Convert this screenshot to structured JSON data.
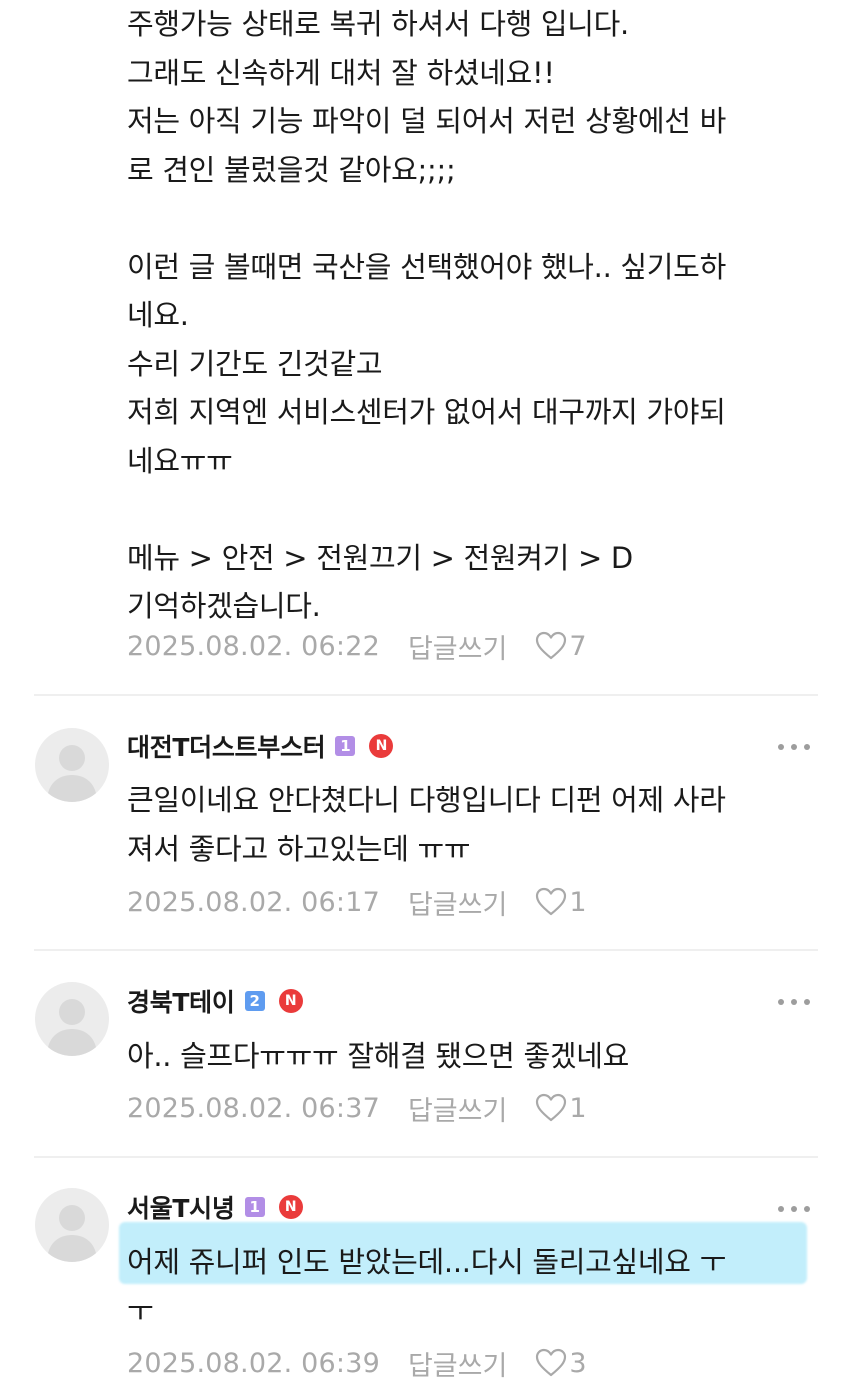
{
  "comments": [
    {
      "body": "주행가능 상태로 복귀 하셔서 다행 입니다.\n그래도 신속하게 대처 잘 하셨네요!!\n저는 아직 기능 파악이 덜 되어서 저런 상황에선 바\n로 견인 불렀을것 같아요;;;;\n\n이런 글 볼때면 국산을 선택했어야 했나.. 싶기도하\n네요.\n수리 기간도 긴것같고\n저희 지역엔 서비스센터가 없어서 대구까지 가야되\n네요ㅠㅠ\n\n메뉴 > 안전 > 전원끄기 > 전원켜기 > D\n기억하겠습니다.",
      "date": "2025.08.02. 06:22",
      "reply_label": "답글쓰기",
      "likes": "7"
    },
    {
      "author": "대전T더스트부스터",
      "rank_badge": "1",
      "rank_color": "#b28ee6",
      "new_badge": "N",
      "body": "큰일이네요 안다쳤다니 다행입니다 디펀 어제 사라\n져서 좋다고 하고있는데 ㅠㅠ",
      "date": "2025.08.02. 06:17",
      "reply_label": "답글쓰기",
      "likes": "1"
    },
    {
      "author": "경북T테이",
      "rank_badge": "2",
      "rank_color": "#5f9cf0",
      "new_badge": "N",
      "body": "아.. 슬프다ㅠㅠㅠ 잘해결 됐으면 좋겠네요",
      "date": "2025.08.02. 06:37",
      "reply_label": "답글쓰기",
      "likes": "1"
    },
    {
      "author": "서울T시녕",
      "rank_badge": "1",
      "rank_color": "#b28ee6",
      "new_badge": "N",
      "body": "어제 쥬니퍼 인도 받았는데...다시 돌리고싶네요 ㅜ\nㅜ",
      "date": "2025.08.02. 06:39",
      "reply_label": "답글쓰기",
      "likes": "3"
    }
  ],
  "colors": {
    "meta_gray": "#a9a9a9",
    "divider": "#efefef",
    "highlight": "#c2eefb",
    "new_badge": "#ea3b3b"
  },
  "icons": {
    "like": "heart-outline-icon",
    "more": "more-horizontal-icon",
    "avatar": "default-profile-icon"
  }
}
